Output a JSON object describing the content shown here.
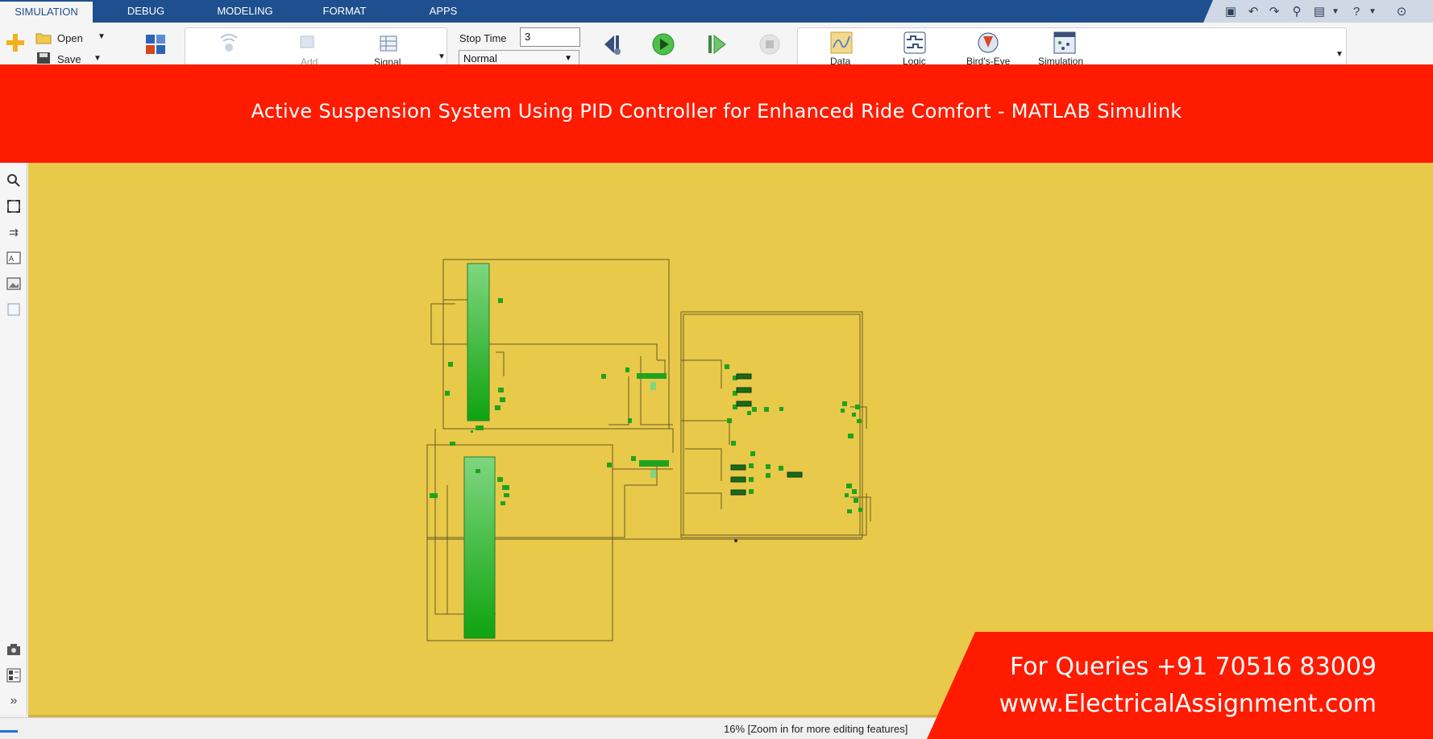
{
  "tabs": [
    {
      "label": "SIMULATION",
      "active": true
    },
    {
      "label": "DEBUG",
      "active": false
    },
    {
      "label": "MODELING",
      "active": false
    },
    {
      "label": "FORMAT",
      "active": false
    },
    {
      "label": "APPS",
      "active": false
    }
  ],
  "toolstrip": {
    "open_label": "Open",
    "save_label": "Save",
    "stop_time_label": "Stop Time",
    "stop_time_value": "3",
    "sim_mode_value": "Normal",
    "signal_label": "Signal",
    "add_label": "Add",
    "data_label": "Data",
    "logic_label": "Logic",
    "birdseye_label": "Bird's-Eye",
    "simulation_label": "Simulation"
  },
  "banner": {
    "title": "Active Suspension System Using PID Controller for Enhanced Ride Comfort - MATLAB Simulink"
  },
  "status": {
    "zoom_text": "16% [Zoom in for more editing features]"
  },
  "card": {
    "phone": "For Queries +91 70516 83009",
    "website": "www.ElectricalAssignment.com"
  },
  "colors": {
    "tabstrip": "#1e4f8e",
    "banner": "#ff1b00",
    "canvas": "#e8c94a",
    "block_green": "#1fa31f"
  },
  "icons": [
    "new-model-icon",
    "open-folder-icon",
    "save-icon",
    "library-browser-icon",
    "log-signals-icon",
    "add-viewer-icon",
    "signal-table-icon",
    "step-back-icon",
    "run-icon",
    "step-forward-icon",
    "stop-icon",
    "data-inspector-icon",
    "logic-analyzer-icon",
    "birds-eye-icon",
    "simulation-manager-icon",
    "zoom-icon",
    "fit-view-icon",
    "arrows-icon",
    "annotation-icon",
    "image-icon",
    "area-icon",
    "camera-icon",
    "model-browser-icon",
    "expand-icon"
  ]
}
